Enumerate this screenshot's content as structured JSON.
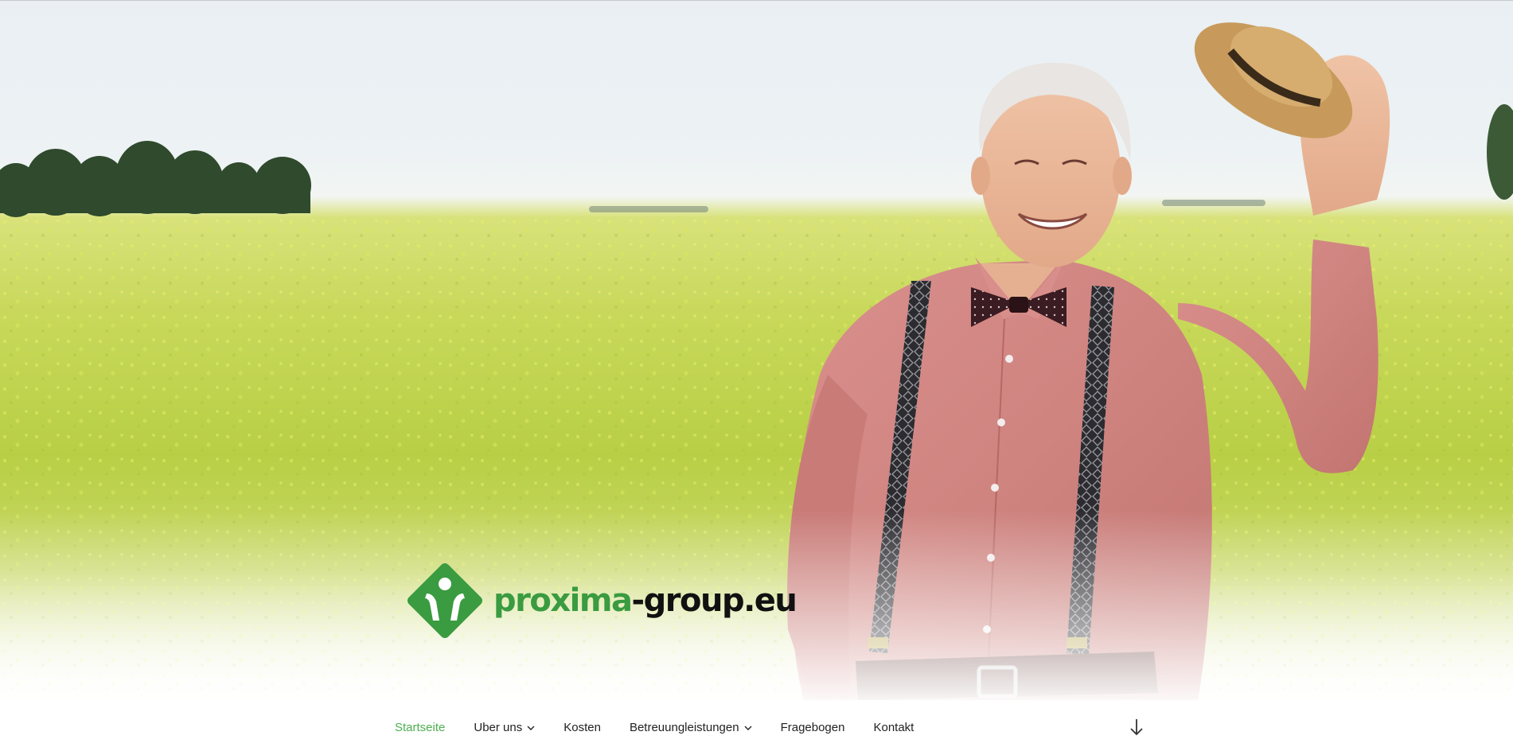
{
  "brand": {
    "name_green": "proxima",
    "name_dark": "-group.eu",
    "color_green": "#3a9b40",
    "color_dark": "#111111"
  },
  "hero": {
    "image": "elderly-man-in-rapeseed-field-tipping-straw-hat"
  },
  "nav": {
    "items": [
      {
        "label": "Startseite",
        "active": true
      },
      {
        "label": "Uber uns",
        "dropdown": true
      },
      {
        "label": "Kosten"
      },
      {
        "label": "Betreuungleistungen",
        "dropdown": true
      },
      {
        "label": "Fragebogen"
      },
      {
        "label": "Kontakt"
      }
    ],
    "active_color": "#4caf50",
    "scroll_icon": "arrow-down-icon"
  }
}
